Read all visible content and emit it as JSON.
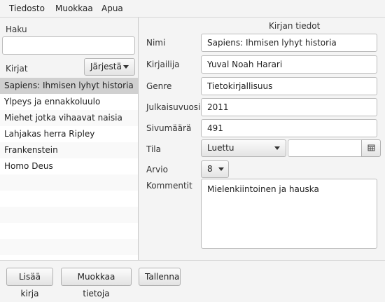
{
  "menubar": {
    "file": "Tiedosto",
    "edit": "Muokkaa",
    "help": "Apua"
  },
  "left": {
    "search_label": "Haku",
    "search_value": "",
    "books_label": "Kirjat",
    "sort_label": "Järjestä",
    "books": [
      "Sapiens: Ihmisen lyhyt historia",
      "Ylpeys ja ennakkoluulo",
      "Miehet jotka vihaavat naisia",
      "Lahjakas herra Ripley",
      "Frankenstein",
      "Homo Deus"
    ],
    "selected_index": 0
  },
  "details": {
    "title": "Kirjan tiedot",
    "name_label": "Nimi",
    "name_value": "Sapiens: Ihmisen lyhyt historia",
    "author_label": "Kirjailija",
    "author_value": "Yuval Noah Harari",
    "genre_label": "Genre",
    "genre_value": "Tietokirjallisuus",
    "year_label": "Julkaisuvuosi",
    "year_value": "2011",
    "pages_label": "Sivumäärä",
    "pages_value": "491",
    "status_label": "Tila",
    "status_value": "Luettu",
    "date_value": "",
    "rating_label": "Arvio",
    "rating_value": "8",
    "comment_label": "Kommentit",
    "comment_value": "Mielenkiintoinen ja hauska"
  },
  "buttons": {
    "add": "Lisää kirja",
    "edit": "Muokkaa tietoja",
    "save": "Tallenna"
  },
  "icons": {
    "calendar": "calendar-icon",
    "dropdown": "chevron-down-icon"
  }
}
